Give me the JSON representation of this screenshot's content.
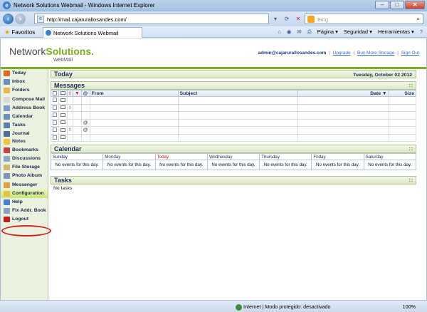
{
  "window": {
    "title": "Network Solutions Webmail - Windows Internet Explorer",
    "url": "http://mail.cajarurallosandes.com/",
    "search_placeholder": "Bing"
  },
  "favorites_bar": {
    "favorites_label": "Favoritos",
    "tab_label": "Network Solutions Webmail",
    "tools": [
      "Página ▾",
      "Seguridad ▾",
      "Herramientas ▾"
    ]
  },
  "header": {
    "logo_main": "Network",
    "logo_accent": "Solutions",
    "logo_dot": ".",
    "logo_sub": "WebMail",
    "user_email": "admin@cajarurallosandes.com",
    "links": [
      "Upgrade",
      "Buy More Storage",
      "Sign Out"
    ]
  },
  "sidebar": {
    "items": [
      {
        "label": "Today",
        "color": "#e26a1b"
      },
      {
        "label": "Inbox",
        "color": "#6b8fc4"
      },
      {
        "label": "Folders",
        "color": "#e8b84a"
      },
      {
        "label": "Compose Mail",
        "color": "#d9d9d9"
      },
      {
        "label": "Address Book",
        "color": "#7a9cc6"
      },
      {
        "label": "Calendar",
        "color": "#6c8fbd"
      },
      {
        "label": "Tasks",
        "color": "#5a7fb0"
      },
      {
        "label": "Journal",
        "color": "#4e6f9a"
      },
      {
        "label": "Notes",
        "color": "#f0c43a"
      },
      {
        "label": "Bookmarks",
        "color": "#c94040"
      },
      {
        "label": "Discussions",
        "color": "#8fa8c8"
      },
      {
        "label": "File Storage",
        "color": "#d9b56a"
      },
      {
        "label": "Photo Album",
        "color": "#7a96b8"
      },
      {
        "label": "Messenger",
        "color": "#e0a040"
      },
      {
        "label": "Configuration",
        "color": "#e8c040"
      },
      {
        "label": "Help",
        "color": "#4a7fd0"
      },
      {
        "label": "Fix Addr. Book",
        "color": "#8aa0c0"
      },
      {
        "label": "Logout",
        "color": "#c02020"
      }
    ],
    "active_item": "Configuration"
  },
  "today_panel": {
    "title": "Today",
    "date": "Tuesday, October 02 2012"
  },
  "messages_panel": {
    "title": "Messages",
    "columns": [
      "From",
      "Subject",
      "Date ▼",
      "Size"
    ],
    "rows": [
      {
        "priority": "",
        "attach": ""
      },
      {
        "priority": "!",
        "attach": ""
      },
      {
        "priority": "",
        "attach": ""
      },
      {
        "priority": "",
        "attach": "@"
      },
      {
        "priority": "!",
        "attach": "@"
      },
      {
        "priority": "",
        "attach": ""
      }
    ]
  },
  "calendar_panel": {
    "title": "Calendar",
    "days": [
      "Sunday",
      "Monday",
      "Today",
      "Wednesday",
      "Thursday",
      "Friday",
      "Saturday"
    ],
    "no_events": "No events for this day."
  },
  "tasks_panel": {
    "title": "Tasks",
    "empty_text": "No tasks"
  },
  "statusbar": {
    "zone_text": "Internet | Modo protegido: desactivado",
    "zoom": "100%"
  }
}
